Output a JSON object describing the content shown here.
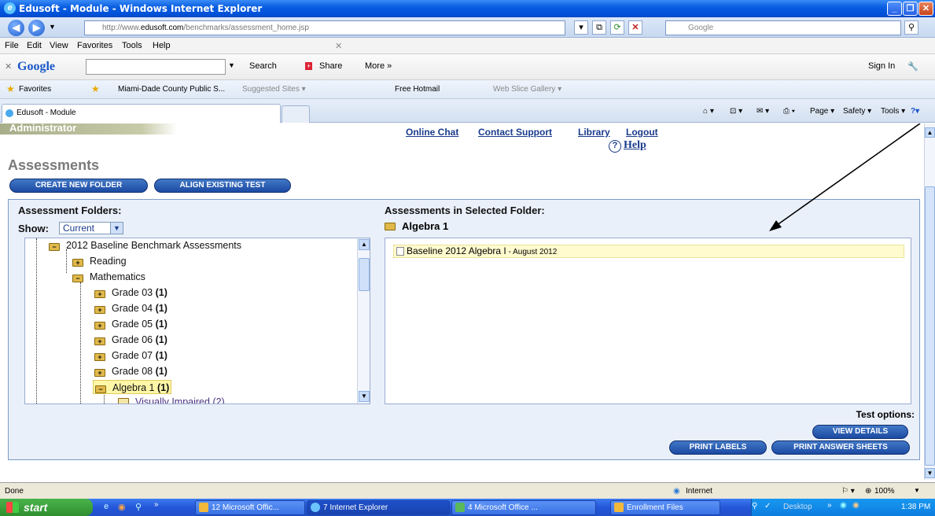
{
  "window": {
    "title": "Edusoft - Module - Windows Internet Explorer"
  },
  "address": {
    "url_prefix": "http://www.",
    "url_domain": "edusoft.com",
    "url_path": "/benchmarks/assessment_home.jsp",
    "search_placeholder": "Google"
  },
  "menu": [
    "File",
    "Edit",
    "View",
    "Favorites",
    "Tools",
    "Help"
  ],
  "google_bar": {
    "logo": "Google",
    "search": "Search",
    "share": "Share",
    "more": "More »",
    "signin": "Sign In"
  },
  "favorites": {
    "label": "Favorites",
    "items": [
      "Miami-Dade County Public S...",
      "Suggested Sites ▾",
      "Free Hotmail",
      "Web Slice Gallery ▾"
    ]
  },
  "tab": {
    "label": "Edusoft - Module"
  },
  "commands": [
    "Page ▾",
    "Safety ▾",
    "Tools ▾"
  ],
  "page": {
    "role": "Administrator",
    "links": [
      "Online Chat",
      "Contact Support",
      "Library",
      "Logout"
    ],
    "help": "Help",
    "heading": "Assessments",
    "buttons": {
      "create": "CREATE NEW FOLDER",
      "align": "ALIGN EXISTING TEST"
    },
    "left_header": "Assessment Folders:",
    "show_label": "Show:",
    "show_value": "Current",
    "tree": [
      {
        "label": "2012 Baseline Benchmark Assessments",
        "count": ""
      },
      {
        "label": "Reading",
        "count": ""
      },
      {
        "label": "Mathematics",
        "count": ""
      },
      {
        "label": "Grade 03 ",
        "count": "(1)"
      },
      {
        "label": "Grade 04 ",
        "count": "(1)"
      },
      {
        "label": "Grade 05 ",
        "count": "(1)"
      },
      {
        "label": "Grade 06 ",
        "count": "(1)"
      },
      {
        "label": "Grade 07 ",
        "count": "(1)"
      },
      {
        "label": "Grade 08 ",
        "count": "(1)"
      },
      {
        "label": "Algebra 1 ",
        "count": "(1)"
      },
      {
        "label": "Visually Impaired ",
        "count": "(2)"
      }
    ],
    "right_header": "Assessments in Selected Folder:",
    "selected_folder": "Algebra 1",
    "assessment": {
      "name": "Baseline 2012 Algebra I",
      "date": " - August 2012"
    },
    "test_options": "Test options:",
    "view_details": "VIEW DETAILS",
    "print_labels": "PRINT LABELS",
    "print_answer": "PRINT ANSWER SHEETS"
  },
  "status": {
    "left": "Done",
    "zone": "Internet",
    "zoom": "100%"
  },
  "taskbar": {
    "start": "start",
    "tasks": [
      "12 Microsoft Offic...",
      "7 Internet Explorer",
      "4 Microsoft Office ...",
      "Enrollment Files"
    ],
    "desktop": "Desktop",
    "time": "1:38 PM"
  }
}
